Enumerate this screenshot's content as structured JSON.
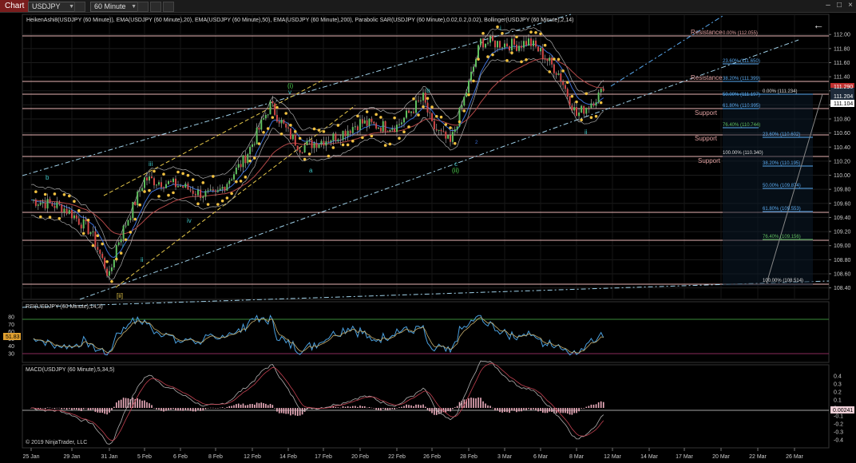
{
  "toolbar": {
    "tab_label": "Chart",
    "instrument": "USDJPY",
    "timeframe": "60 Minute",
    "back_icon": "arrow-left-icon"
  },
  "price_panel": {
    "indicators_label": "HeikenAshi8(USDJPY (60 Minute)), EMA(USDJPY (60 Minute),20), EMA(USDJPY (60 Minute),50), EMA(USDJPY (60 Minute),200), Parabolic SAR(USDJPY (60 Minute),0.02,0.2,0.02), Bollinger(USDJPY (60 Minute),2,14)",
    "y_ticks": [
      "112.00",
      "111.80",
      "111.60",
      "111.40",
      "111.20",
      "111.00",
      "110.80",
      "110.60",
      "110.40",
      "110.20",
      "110.00",
      "109.80",
      "109.60",
      "109.40",
      "109.20",
      "109.00",
      "108.80",
      "108.60",
      "108.40"
    ],
    "price_tags": [
      {
        "label": "111.290",
        "color": "#ffffff",
        "bg": "#1e2a3a"
      },
      {
        "label": "111.204",
        "color": "#ffffff",
        "bg": "#1e2a3a"
      },
      {
        "label": "111.104",
        "color": "#000000",
        "bg": "#ffffff"
      }
    ],
    "zone_labels": [
      {
        "text": "Resistance",
        "level": "upper"
      },
      {
        "text": "Resistance",
        "level": "mid"
      },
      {
        "text": "Support",
        "level": "s1"
      },
      {
        "text": "Support",
        "level": "s2"
      },
      {
        "text": "Support",
        "level": "s3"
      }
    ],
    "fib_upper": [
      {
        "text": "0.00% (112.055)"
      },
      {
        "text": "23.60% (111.650)"
      },
      {
        "text": "38.20% (111.399)"
      },
      {
        "text": "50.00% (111.197)"
      },
      {
        "text": "61.80% (110.995)"
      },
      {
        "text": "76.40% (110.744)"
      },
      {
        "text": "100.00% (110.340)"
      }
    ],
    "fib_lower": [
      {
        "text": "0.00% (111.234)"
      },
      {
        "text": "23.60% (110.602)"
      },
      {
        "text": "38.20% (110.195)"
      },
      {
        "text": "50.00% (109.874)"
      },
      {
        "text": "61.80% (109.553)"
      },
      {
        "text": "76.40% (109.156)"
      },
      {
        "text": "100.00% (108.514)"
      }
    ],
    "wave_labels": [
      "b",
      "iii",
      "iv",
      "i",
      "ii",
      "(i)",
      "v",
      "a",
      "b",
      "c",
      "(ii)",
      "2",
      "i",
      "ii",
      "[ii]"
    ]
  },
  "rsi_panel": {
    "label": "RSI(USDJPY (60 Minute),14,3)",
    "y_ticks": [
      "80",
      "70",
      "60",
      "50",
      "40",
      "30"
    ],
    "value_tag": "51.83"
  },
  "macd_panel": {
    "label": "MACD(USDJPY (60 Minute),5,34,5)",
    "y_ticks": [
      "0.4",
      "0.3",
      "0.2",
      "0.1",
      "0",
      "-0.1",
      "-0.2",
      "-0.3",
      "-0.4"
    ],
    "value_tag": "0.00241"
  },
  "copyright": "© 2019 NinjaTrader, LLC",
  "x_ticks": [
    "25 Jan",
    "29 Jan",
    "31 Jan",
    "5 Feb",
    "6 Feb",
    "8 Feb",
    "12 Feb",
    "14 Feb",
    "17 Feb",
    "20 Feb",
    "22 Feb",
    "26 Feb",
    "28 Feb",
    "3 Mar",
    "6 Mar",
    "8 Mar",
    "12 Mar",
    "14 Mar",
    "17 Mar",
    "20 Mar",
    "22 Mar",
    "26 Mar"
  ],
  "colors": {
    "background": "#000000",
    "grid": "#2a2a2a",
    "resistance_line": "#e8b4b4",
    "ema_blue": "#3c6fd6",
    "ema_red": "#b34848",
    "sar": "#f0c040",
    "fib_blue": "#5aaaf0",
    "channel": "#9fd0e8"
  },
  "chart_data": {
    "type": "line",
    "title": "",
    "x_range": [
      "2019-01-25",
      "2019-03-26"
    ],
    "ylim": [
      108.35,
      112.15
    ],
    "close_path": [
      [
        "2019-01-25",
        109.65
      ],
      [
        "2019-01-28",
        109.55
      ],
      [
        "2019-01-29",
        109.45
      ],
      [
        "2019-01-30",
        109.2
      ],
      [
        "2019-01-31",
        108.55
      ],
      [
        "2019-02-01",
        109.0
      ],
      [
        "2019-02-04",
        109.7
      ],
      [
        "2019-02-05",
        109.95
      ],
      [
        "2019-02-06",
        109.85
      ],
      [
        "2019-02-07",
        109.75
      ],
      [
        "2019-02-08",
        109.7
      ],
      [
        "2019-02-11",
        110.2
      ],
      [
        "2019-02-12",
        110.45
      ],
      [
        "2019-02-13",
        111.0
      ],
      [
        "2019-02-14",
        110.6
      ],
      [
        "2019-02-15",
        110.4
      ],
      [
        "2019-02-18",
        110.55
      ],
      [
        "2019-02-19",
        110.65
      ],
      [
        "2019-02-20",
        110.75
      ],
      [
        "2019-02-21",
        110.7
      ],
      [
        "2019-02-22",
        110.7
      ],
      [
        "2019-02-25",
        111.1
      ],
      [
        "2019-02-26",
        110.7
      ],
      [
        "2019-02-27",
        110.45
      ],
      [
        "2019-02-28",
        111.3
      ],
      [
        "2019-03-01",
        111.9
      ],
      [
        "2019-03-04",
        111.85
      ],
      [
        "2019-03-05",
        111.9
      ],
      [
        "2019-03-06",
        111.75
      ],
      [
        "2019-03-07",
        111.45
      ],
      [
        "2019-03-08",
        110.85
      ],
      [
        "2019-03-11",
        111.2
      ]
    ],
    "rsi": {
      "ylim": [
        20,
        90
      ],
      "last": 51.83
    },
    "macd": {
      "ylim": [
        -0.45,
        0.45
      ],
      "last": 0.00241
    }
  }
}
